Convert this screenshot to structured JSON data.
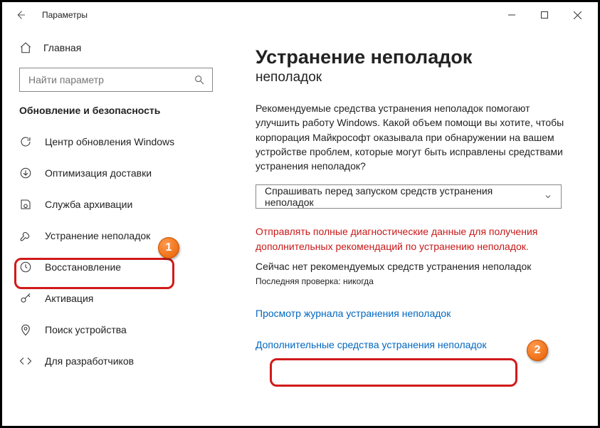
{
  "window": {
    "title": "Параметры"
  },
  "sidebar": {
    "home_label": "Главная",
    "search_placeholder": "Найти параметр",
    "section_label": "Обновление и безопасность",
    "items": [
      {
        "label": "Центр обновления Windows",
        "icon": "refresh"
      },
      {
        "label": "Оптимизация доставки",
        "icon": "download"
      },
      {
        "label": "Служба архивации",
        "icon": "backup"
      },
      {
        "label": "Устранение неполадок",
        "icon": "wrench"
      },
      {
        "label": "Восстановление",
        "icon": "recovery"
      },
      {
        "label": "Активация",
        "icon": "key"
      },
      {
        "label": "Поиск устройства",
        "icon": "location"
      },
      {
        "label": "Для разработчиков",
        "icon": "code"
      }
    ]
  },
  "main": {
    "title": "Устранение неполадок",
    "subtitle": "неполадок",
    "description": "Рекомендуемые средства устранения неполадок помогают улучшить работу Windows. Какой объем помощи вы хотите, чтобы корпорация Майкрософт оказывала при обнаружении на вашем устройстве проблем, которые могут быть исправлены средствами устранения неполадок?",
    "dropdown_label": "Спрашивать перед запуском средств устранения неполадок",
    "diagnostic_warning": "Отправлять полные диагностические данные для получения дополнительных рекомендаций по устранению неполадок.",
    "no_recommended": "Сейчас нет рекомендуемых средств устранения неполадок",
    "last_check": "Последняя проверка: никогда",
    "link_history": "Просмотр журнала устранения неполадок",
    "link_additional": "Дополнительные средства устранения неполадок"
  },
  "callouts": {
    "one": "1",
    "two": "2"
  }
}
